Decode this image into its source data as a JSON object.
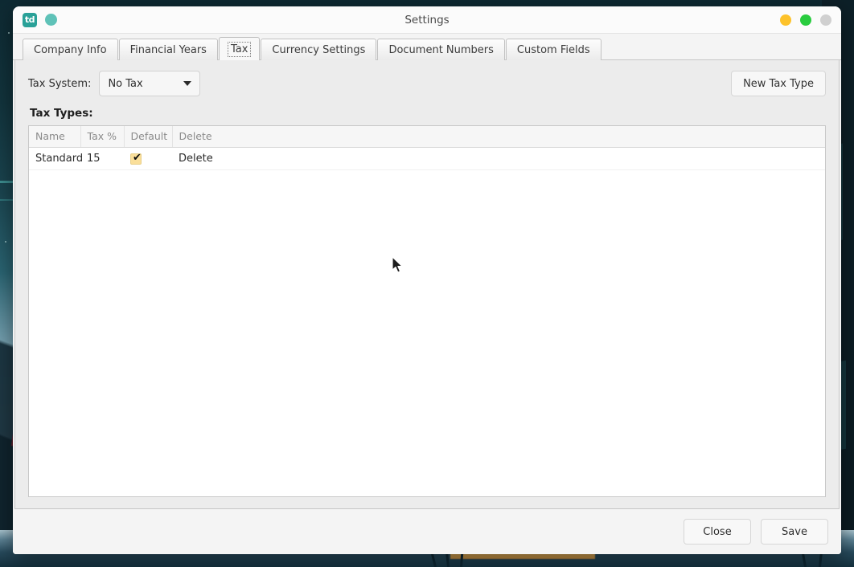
{
  "window": {
    "title": "Settings",
    "app_icon_text": "td",
    "app_icon_name": "td-app-logo",
    "status_dot_name": "teal-status-dot",
    "controls": [
      {
        "name": "minimize-button",
        "color": "#fdc22a"
      },
      {
        "name": "maximize-button",
        "color": "#29cc3f"
      },
      {
        "name": "close-button",
        "color": "#d0d0d0"
      }
    ]
  },
  "tabs": [
    {
      "label": "Company Info",
      "active": false
    },
    {
      "label": "Financial Years",
      "active": false
    },
    {
      "label": "Tax",
      "active": true
    },
    {
      "label": "Currency Settings",
      "active": false
    },
    {
      "label": "Document Numbers",
      "active": false
    },
    {
      "label": "Custom Fields",
      "active": false
    }
  ],
  "tax_panel": {
    "tax_system_label": "Tax System:",
    "tax_system_value": "No Tax",
    "tax_system_options": [
      "No Tax"
    ],
    "new_tax_type_label": "New Tax Type",
    "heading": "Tax Types:",
    "columns": [
      "Name",
      "Tax %",
      "Default",
      "Delete"
    ],
    "rows": [
      {
        "name": "Standard",
        "tax_percent": "15",
        "default_checked": true,
        "delete_label": "Delete"
      }
    ]
  },
  "footer": {
    "close_label": "Close",
    "save_label": "Save"
  },
  "colors": {
    "accent_teal": "#2aa198",
    "checkbox_fill": "#fadf9a",
    "minimize": "#fdc22a",
    "maximize": "#29cc3f",
    "close": "#d0d0d0"
  }
}
